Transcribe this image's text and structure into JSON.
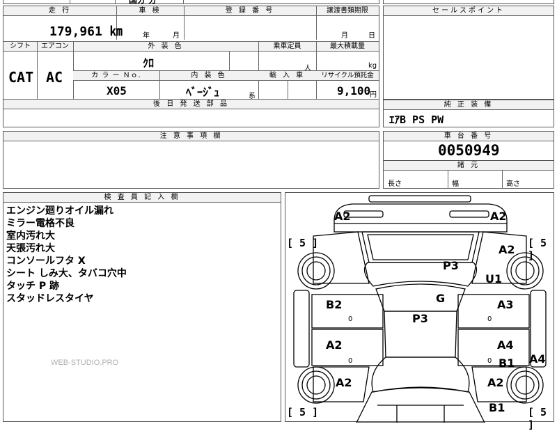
{
  "top_row": {
    "partial_text": "国分 分"
  },
  "vehicle_info": {
    "mileage_label": "走 行",
    "mileage_value": "179,961 ㎞",
    "inspection_label": "車 検",
    "inspection_year_unit": "年",
    "inspection_month_unit": "月",
    "registration_label": "登 録 番 号",
    "transfer_doc_label": "譲渡書類期限",
    "transfer_month_unit": "月",
    "transfer_day_unit": "日",
    "shift_label": "シフト",
    "shift_value": "CAT",
    "aircon_label": "エアコン",
    "aircon_value": "AC",
    "exterior_color_label": "外 装 色",
    "exterior_color_value": "ｸﾛ",
    "capacity_label": "乗車定員",
    "capacity_unit": "人",
    "max_load_label": "最大積載量",
    "max_load_unit": "kg",
    "color_no_label": "カ ラ ー Ｎｏ.",
    "color_no_value": "X05",
    "interior_color_label": "内 装 色",
    "interior_color_value": "ﾍﾞｰｼﾞｭ",
    "interior_color_suffix": "系",
    "import_label": "輸 入 車",
    "recycle_label": "リサイクル預託金",
    "recycle_value": "9,100",
    "recycle_unit": "円",
    "later_parts_label": "後 日 発 送 部 品"
  },
  "sales_point": {
    "label": "セールスポイント"
  },
  "standard_equipment": {
    "label": "純 正 装 備",
    "value": "ｴｱB PS PW"
  },
  "notes": {
    "label": "注 意 事 項 欄"
  },
  "chassis": {
    "label": "車 台 番 号",
    "value": "0050949"
  },
  "specs": {
    "label": "諸 元",
    "length_label": "長さ",
    "width_label": "幅",
    "height_label": "高さ"
  },
  "inspector": {
    "label": "検 査 員 記 入 欄",
    "remarks": [
      "エンジン廻りオイル漏れ",
      "ミラー電格不良",
      "室内汚れ大",
      "天張汚れ大",
      "コンソールフタ X",
      "シート しみ大、タバコ穴中",
      "タッチ P 跡",
      "スタッドレスタイヤ"
    ],
    "watermark": "WEB-STUDIO.PRO"
  },
  "damage_map": {
    "marks": {
      "front_left": "A2",
      "front_right": "A2",
      "hood_right": "A2",
      "roof": "P3",
      "right_pillar": "U1",
      "glass": "G",
      "left_front_door": "B2",
      "interior": "P3",
      "right_front_door": "A3",
      "left_rear_door": "A2",
      "right_rear_door": "A4",
      "right_rear_door_b": "B1",
      "right_sill": "A4",
      "rear_left": "A2",
      "rear_right": "A2",
      "rear_bottom": "B1"
    },
    "tire_labels": {
      "front_left": "[ 5 ]",
      "front_right": "[ 5 ]",
      "rear_left": "[ 5 ]",
      "rear_right": "[ 5 ]"
    },
    "door_small_marks": [
      "0",
      "0",
      "0",
      "0"
    ]
  }
}
